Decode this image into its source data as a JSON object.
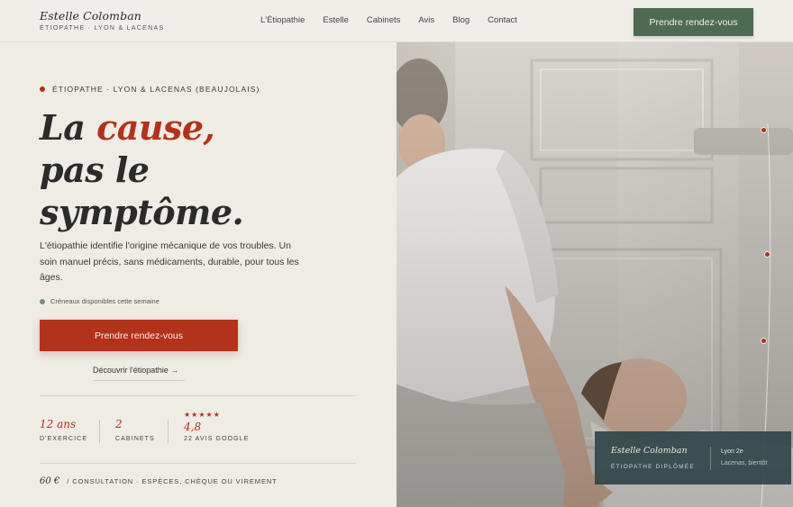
{
  "header": {
    "brand_name": "Estelle Colomban",
    "brand_sub": "ÉTIOPATHE · LYON & LACENAS",
    "nav": [
      "L'Étiopathie",
      "Estelle",
      "Cabinets",
      "Avis",
      "Blog",
      "Contact"
    ],
    "cta": "Prendre rendez-vous"
  },
  "hero": {
    "eyebrow": "ÉTIOPATHE · LYON & LACENAS (BEAUJOLAIS)",
    "headline_pre": "La ",
    "headline_accent": "cause,",
    "headline_line2": "pas le",
    "headline_line3": "symptôme.",
    "lead": "L'étiopathie identifie l'origine mécanique de vos troubles. Un soin manuel précis, sans médicaments, durable, pour tous les âges.",
    "availability": "Créneaux disponibles cette semaine",
    "cta": "Prendre rendez-vous",
    "discover": "Découvrir l'étiopathie →"
  },
  "stats": [
    {
      "value": "12 ans",
      "label": "D'EXERCICE"
    },
    {
      "value": "2",
      "label": "CABINETS"
    },
    {
      "stars": "★★★★★",
      "value": "4,8",
      "label": "22 AVIS GOOGLE"
    }
  ],
  "price": {
    "amount": "60 €",
    "note": "/ CONSULTATION · ESPÈCES, CHÈQUE OU VIREMENT"
  },
  "caption": {
    "name": "Estelle Colomban",
    "title": "ÉTIOPATHE DIPLÔMÉE",
    "city1": "Lyon 2e",
    "city2": "Lacenas, bientôt"
  },
  "colors": {
    "accent_red": "#b2321b",
    "brand_green": "#4d6b52",
    "background": "#efebe5"
  }
}
